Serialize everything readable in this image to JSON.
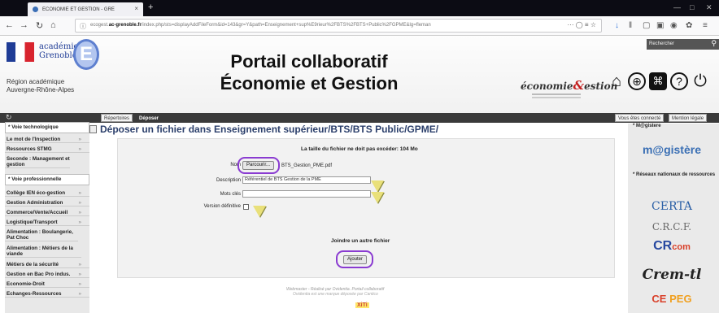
{
  "browser": {
    "tab_title": "ECONOMIE ET GESTION - GRE",
    "tab_close": "×",
    "new_tab": "+",
    "url_prefix": "ecogest.",
    "url_domain": "ac-grenoble.fr",
    "url_rest": "/index.php/sts=displayAddFileForm&id=143&gr=Y&path=Enseignement+sup%E9rieur%2FBTS%2FBTS+Public%2FGPME&lg=fleman",
    "url_more": "···"
  },
  "header": {
    "academie_line1": "académie",
    "academie_line2": "Grenoble",
    "academie_letter": "E",
    "region_line1": "Région académique",
    "region_line2": "Auvergne-Rhône-Alpes",
    "title_line1": "Portail collaboratif",
    "title_line2": "Économie et Gestion",
    "eco_logo_text1": "économie",
    "eco_logo_amp": "&",
    "eco_logo_text2": "estion",
    "search_label": "Rechercher",
    "icon_home": "⌂",
    "icon_globe": "⊕",
    "icon_rss": "⌘",
    "icon_help": "?",
    "icon_power": "⏻"
  },
  "nav": {
    "refresh": "↻",
    "repertoires": "Répertoires",
    "deposer": "Déposer",
    "connected": "Vous êtes connecté",
    "mention": "Mention légale"
  },
  "sidebar": {
    "head1": "Voie technologique",
    "items1": [
      "Le mot de l'Inspection",
      "Ressources STMG",
      "Seconde : Management et gestion"
    ],
    "head2": "Voie professionnelle",
    "items2": [
      "Collège IEN éco-gestion",
      "Gestion Administration",
      "Commerce/Vente/Accueil",
      "Logistique/Transport",
      "Alimentation : Boulangerie, Pat Choc",
      "Alimentation : Métiers de la viande",
      "Métiers de la sécurité",
      "Gestion en Bac Pro indus.",
      "Economie-Droit",
      "Echanges-Ressources"
    ],
    "arrow": "»"
  },
  "main": {
    "page_title": "Déposer un fichier dans Enseignement supérieur/BTS/BTS Public/GPME/",
    "max_size_note": "La taille du fichier ne doit pas excéder: 104 Mo",
    "label_nom": "Nom",
    "browse_button": "Parcourir...",
    "file_name": "BTS_Gestion_PME.pdf",
    "label_description": "Description",
    "description_value": "Référentiel de BTS Gestion de la PME",
    "label_keywords": "Mots clés",
    "keywords_value": "",
    "label_final": "Version définitive",
    "join_text": "Joindre un autre fichier",
    "add_button": "Ajouter",
    "footer_line1": "Webmaster - Réalisé par Ovidentia. Portail collaboratif",
    "footer_line2": "Ovidentia est une marque déposée par Cantico",
    "xiti": "XiTi"
  },
  "right_sidebar": {
    "magistere_head": "M@gistere",
    "magistere_logo": "m@gistère",
    "networks_head": "Réseaux nationaux de ressources",
    "certa": "CERTA",
    "crcf": "C.R.C.F.",
    "crcom_c": "CR",
    "crcom_rest": "com",
    "cremtl": "Crem-tl",
    "cepeg1": "CE",
    "cepeg2": "PEG"
  },
  "colors": {
    "accent_purple": "#8a3bd1",
    "title_blue": "#2b3f6b",
    "magistere_blue": "#3a6fb4"
  }
}
